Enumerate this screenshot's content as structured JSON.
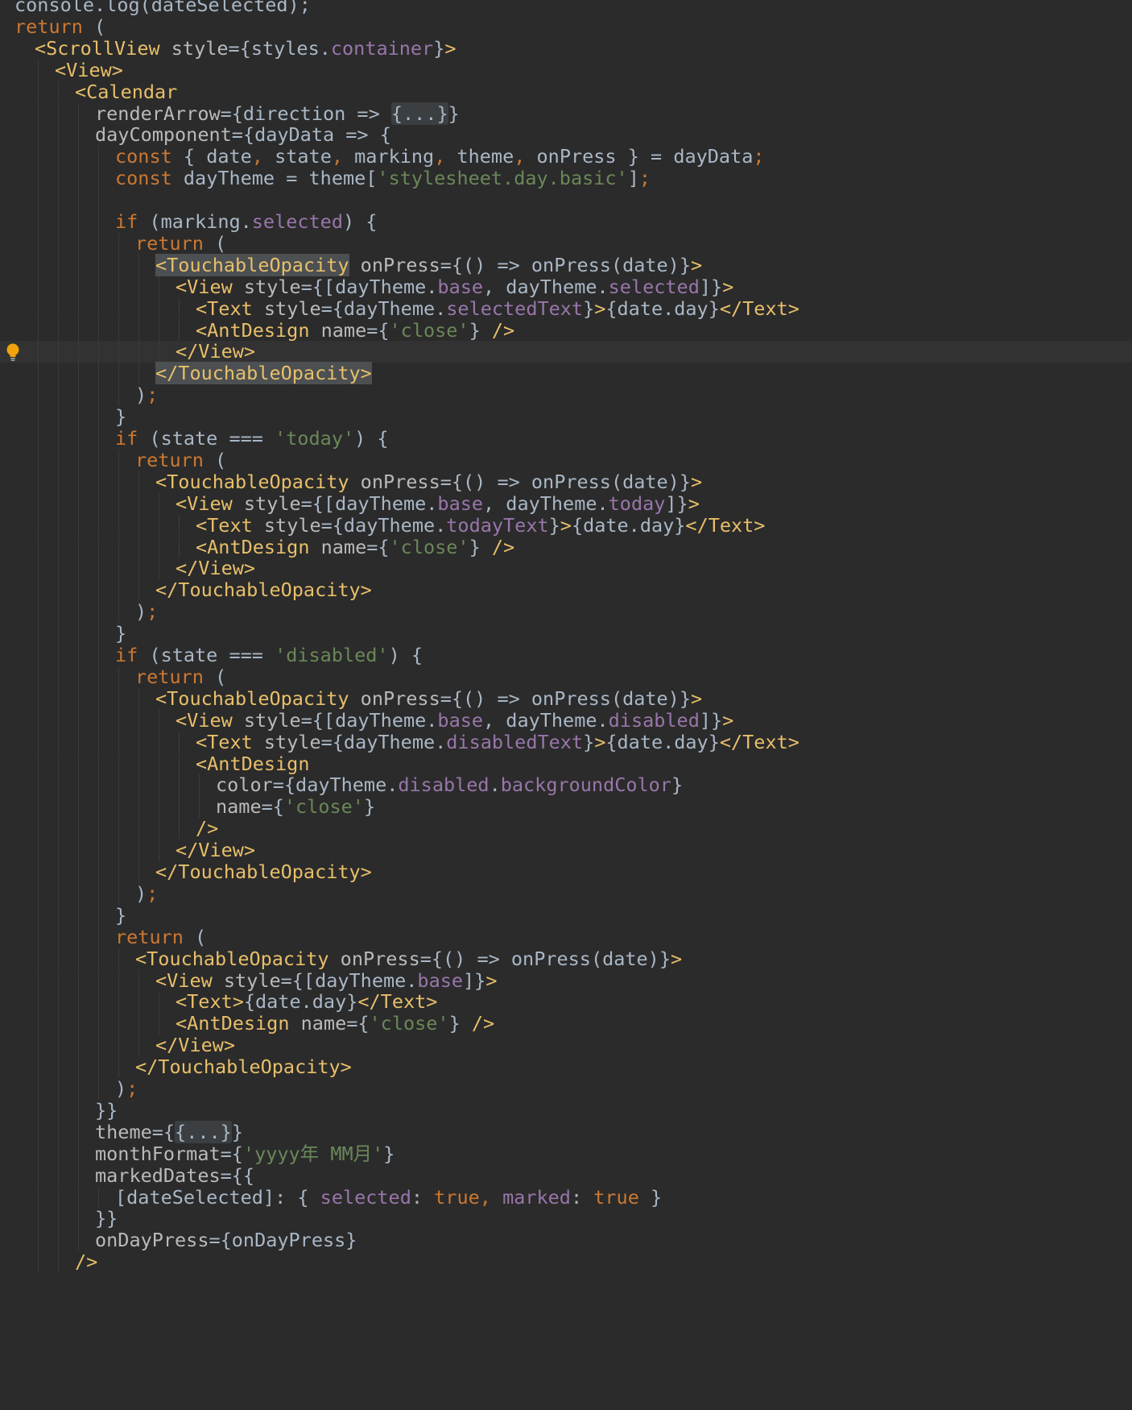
{
  "editor": {
    "theme": "darcula",
    "colors": {
      "background": "#2b2b2b",
      "current_line": "#323232",
      "keyword": "#cc7832",
      "tag": "#e8bf6a",
      "attribute": "#bababa",
      "property": "#9876aa",
      "string": "#6a8759",
      "default": "#a9b7c6",
      "highlight": "#4c5052"
    },
    "gutter_icon": "lightbulb-icon",
    "current_line_index": 16,
    "lines": [
      {
        "indent": 0,
        "tokens": [
          {
            "t": "console.log(dateSelected);",
            "c": "plain"
          }
        ]
      },
      {
        "indent": 0,
        "tokens": [
          {
            "t": "return",
            "c": "kw"
          },
          {
            "t": " (",
            "c": "plain"
          }
        ]
      },
      {
        "indent": 1,
        "tokens": [
          {
            "t": "<ScrollView",
            "c": "tag"
          },
          {
            "t": " style",
            "c": "attr"
          },
          {
            "t": "={styles.",
            "c": "plain"
          },
          {
            "t": "container",
            "c": "prop"
          },
          {
            "t": "}",
            "c": "plain"
          },
          {
            "t": ">",
            "c": "tag"
          }
        ]
      },
      {
        "indent": 2,
        "tokens": [
          {
            "t": "<View>",
            "c": "tag"
          }
        ]
      },
      {
        "indent": 3,
        "tokens": [
          {
            "t": "<Calendar",
            "c": "tag"
          }
        ]
      },
      {
        "indent": 4,
        "tokens": [
          {
            "t": "renderArrow",
            "c": "attr"
          },
          {
            "t": "={direction => ",
            "c": "plain"
          },
          {
            "t": "{...}",
            "c": "fold"
          },
          {
            "t": "}",
            "c": "plain"
          }
        ]
      },
      {
        "indent": 4,
        "tokens": [
          {
            "t": "dayComponent",
            "c": "attr"
          },
          {
            "t": "={dayData => {",
            "c": "plain"
          }
        ]
      },
      {
        "indent": 5,
        "tokens": [
          {
            "t": "const",
            "c": "kw"
          },
          {
            "t": " { date",
            "c": "plain"
          },
          {
            "t": ",",
            "c": "kw"
          },
          {
            "t": " state",
            "c": "plain"
          },
          {
            "t": ",",
            "c": "kw"
          },
          {
            "t": " marking",
            "c": "plain"
          },
          {
            "t": ",",
            "c": "kw"
          },
          {
            "t": " theme",
            "c": "plain"
          },
          {
            "t": ",",
            "c": "kw"
          },
          {
            "t": " onPress } = dayData",
            "c": "plain"
          },
          {
            "t": ";",
            "c": "kw"
          }
        ]
      },
      {
        "indent": 5,
        "tokens": [
          {
            "t": "const",
            "c": "kw"
          },
          {
            "t": " dayTheme = theme[",
            "c": "plain"
          },
          {
            "t": "'stylesheet.day.basic'",
            "c": "str"
          },
          {
            "t": "]",
            "c": "plain"
          },
          {
            "t": ";",
            "c": "kw"
          }
        ]
      },
      {
        "indent": 5,
        "tokens": []
      },
      {
        "indent": 5,
        "tokens": [
          {
            "t": "if",
            "c": "kw"
          },
          {
            "t": " (marking.",
            "c": "plain"
          },
          {
            "t": "selected",
            "c": "prop"
          },
          {
            "t": ") {",
            "c": "plain"
          }
        ]
      },
      {
        "indent": 6,
        "tokens": [
          {
            "t": "return",
            "c": "kw"
          },
          {
            "t": " (",
            "c": "plain"
          }
        ]
      },
      {
        "indent": 7,
        "tokens": [
          {
            "t": "<TouchableOpacity",
            "c": "tag",
            "hl": true
          },
          {
            "t": " onPress",
            "c": "attr"
          },
          {
            "t": "={() => onPress(date)}",
            "c": "plain"
          },
          {
            "t": ">",
            "c": "tag"
          }
        ]
      },
      {
        "indent": 8,
        "tokens": [
          {
            "t": "<View",
            "c": "tag"
          },
          {
            "t": " style",
            "c": "attr"
          },
          {
            "t": "={[dayTheme.",
            "c": "plain"
          },
          {
            "t": "base",
            "c": "prop"
          },
          {
            "t": ", dayTheme.",
            "c": "plain"
          },
          {
            "t": "selected",
            "c": "prop"
          },
          {
            "t": "]}",
            "c": "plain"
          },
          {
            "t": ">",
            "c": "tag"
          }
        ]
      },
      {
        "indent": 9,
        "tokens": [
          {
            "t": "<Text",
            "c": "tag"
          },
          {
            "t": " style",
            "c": "attr"
          },
          {
            "t": "={dayTheme.",
            "c": "plain"
          },
          {
            "t": "selectedText",
            "c": "prop"
          },
          {
            "t": "}",
            "c": "plain"
          },
          {
            "t": ">",
            "c": "tag"
          },
          {
            "t": "{date.day}",
            "c": "plain"
          },
          {
            "t": "</Text>",
            "c": "tag"
          }
        ]
      },
      {
        "indent": 9,
        "tokens": [
          {
            "t": "<AntDesign",
            "c": "tag"
          },
          {
            "t": " name",
            "c": "attr"
          },
          {
            "t": "={",
            "c": "plain"
          },
          {
            "t": "'close'",
            "c": "str"
          },
          {
            "t": "} ",
            "c": "plain"
          },
          {
            "t": "/>",
            "c": "tag"
          }
        ]
      },
      {
        "indent": 8,
        "tokens": [
          {
            "t": "</View>",
            "c": "tag"
          }
        ]
      },
      {
        "indent": 7,
        "tokens": [
          {
            "t": "</TouchableOpacity>",
            "c": "tag",
            "hl": true
          }
        ]
      },
      {
        "indent": 6,
        "tokens": [
          {
            "t": ")",
            "c": "plain"
          },
          {
            "t": ";",
            "c": "kw"
          }
        ]
      },
      {
        "indent": 5,
        "tokens": [
          {
            "t": "}",
            "c": "plain"
          }
        ]
      },
      {
        "indent": 5,
        "tokens": [
          {
            "t": "if",
            "c": "kw"
          },
          {
            "t": " (state === ",
            "c": "plain"
          },
          {
            "t": "'today'",
            "c": "str"
          },
          {
            "t": ") {",
            "c": "plain"
          }
        ]
      },
      {
        "indent": 6,
        "tokens": [
          {
            "t": "return",
            "c": "kw"
          },
          {
            "t": " (",
            "c": "plain"
          }
        ]
      },
      {
        "indent": 7,
        "tokens": [
          {
            "t": "<TouchableOpacity",
            "c": "tag"
          },
          {
            "t": " onPress",
            "c": "attr"
          },
          {
            "t": "={() => onPress(date)}",
            "c": "plain"
          },
          {
            "t": ">",
            "c": "tag"
          }
        ]
      },
      {
        "indent": 8,
        "tokens": [
          {
            "t": "<View",
            "c": "tag"
          },
          {
            "t": " style",
            "c": "attr"
          },
          {
            "t": "={[dayTheme.",
            "c": "plain"
          },
          {
            "t": "base",
            "c": "prop"
          },
          {
            "t": ", dayTheme.",
            "c": "plain"
          },
          {
            "t": "today",
            "c": "prop"
          },
          {
            "t": "]}",
            "c": "plain"
          },
          {
            "t": ">",
            "c": "tag"
          }
        ]
      },
      {
        "indent": 9,
        "tokens": [
          {
            "t": "<Text",
            "c": "tag"
          },
          {
            "t": " style",
            "c": "attr"
          },
          {
            "t": "={dayTheme.",
            "c": "plain"
          },
          {
            "t": "todayText",
            "c": "prop"
          },
          {
            "t": "}",
            "c": "plain"
          },
          {
            "t": ">",
            "c": "tag"
          },
          {
            "t": "{date.day}",
            "c": "plain"
          },
          {
            "t": "</Text>",
            "c": "tag"
          }
        ]
      },
      {
        "indent": 9,
        "tokens": [
          {
            "t": "<AntDesign",
            "c": "tag"
          },
          {
            "t": " name",
            "c": "attr"
          },
          {
            "t": "={",
            "c": "plain"
          },
          {
            "t": "'close'",
            "c": "str"
          },
          {
            "t": "} ",
            "c": "plain"
          },
          {
            "t": "/>",
            "c": "tag"
          }
        ]
      },
      {
        "indent": 8,
        "tokens": [
          {
            "t": "</View>",
            "c": "tag"
          }
        ]
      },
      {
        "indent": 7,
        "tokens": [
          {
            "t": "</TouchableOpacity>",
            "c": "tag"
          }
        ]
      },
      {
        "indent": 6,
        "tokens": [
          {
            "t": ")",
            "c": "plain"
          },
          {
            "t": ";",
            "c": "kw"
          }
        ]
      },
      {
        "indent": 5,
        "tokens": [
          {
            "t": "}",
            "c": "plain"
          }
        ]
      },
      {
        "indent": 5,
        "tokens": [
          {
            "t": "if",
            "c": "kw"
          },
          {
            "t": " (state === ",
            "c": "plain"
          },
          {
            "t": "'disabled'",
            "c": "str"
          },
          {
            "t": ") {",
            "c": "plain"
          }
        ]
      },
      {
        "indent": 6,
        "tokens": [
          {
            "t": "return",
            "c": "kw"
          },
          {
            "t": " (",
            "c": "plain"
          }
        ]
      },
      {
        "indent": 7,
        "tokens": [
          {
            "t": "<TouchableOpacity",
            "c": "tag"
          },
          {
            "t": " onPress",
            "c": "attr"
          },
          {
            "t": "={() => onPress(date)}",
            "c": "plain"
          },
          {
            "t": ">",
            "c": "tag"
          }
        ]
      },
      {
        "indent": 8,
        "tokens": [
          {
            "t": "<View",
            "c": "tag"
          },
          {
            "t": " style",
            "c": "attr"
          },
          {
            "t": "={[dayTheme.",
            "c": "plain"
          },
          {
            "t": "base",
            "c": "prop"
          },
          {
            "t": ", dayTheme.",
            "c": "plain"
          },
          {
            "t": "disabled",
            "c": "prop"
          },
          {
            "t": "]}",
            "c": "plain"
          },
          {
            "t": ">",
            "c": "tag"
          }
        ]
      },
      {
        "indent": 9,
        "tokens": [
          {
            "t": "<Text",
            "c": "tag"
          },
          {
            "t": " style",
            "c": "attr"
          },
          {
            "t": "={dayTheme.",
            "c": "plain"
          },
          {
            "t": "disabledText",
            "c": "prop"
          },
          {
            "t": "}",
            "c": "plain"
          },
          {
            "t": ">",
            "c": "tag"
          },
          {
            "t": "{date.day}",
            "c": "plain"
          },
          {
            "t": "</Text>",
            "c": "tag"
          }
        ]
      },
      {
        "indent": 9,
        "tokens": [
          {
            "t": "<AntDesign",
            "c": "tag"
          }
        ]
      },
      {
        "indent": 10,
        "tokens": [
          {
            "t": "color",
            "c": "attr"
          },
          {
            "t": "={dayTheme.",
            "c": "plain"
          },
          {
            "t": "disabled",
            "c": "prop"
          },
          {
            "t": ".",
            "c": "plain"
          },
          {
            "t": "backgroundColor",
            "c": "prop"
          },
          {
            "t": "}",
            "c": "plain"
          }
        ]
      },
      {
        "indent": 10,
        "tokens": [
          {
            "t": "name",
            "c": "attr"
          },
          {
            "t": "={",
            "c": "plain"
          },
          {
            "t": "'close'",
            "c": "str"
          },
          {
            "t": "}",
            "c": "plain"
          }
        ]
      },
      {
        "indent": 9,
        "tokens": [
          {
            "t": "/>",
            "c": "tag"
          }
        ]
      },
      {
        "indent": 8,
        "tokens": [
          {
            "t": "</View>",
            "c": "tag"
          }
        ]
      },
      {
        "indent": 7,
        "tokens": [
          {
            "t": "</TouchableOpacity>",
            "c": "tag"
          }
        ]
      },
      {
        "indent": 6,
        "tokens": [
          {
            "t": ")",
            "c": "plain"
          },
          {
            "t": ";",
            "c": "kw"
          }
        ]
      },
      {
        "indent": 5,
        "tokens": [
          {
            "t": "}",
            "c": "plain"
          }
        ]
      },
      {
        "indent": 5,
        "tokens": [
          {
            "t": "return",
            "c": "kw"
          },
          {
            "t": " (",
            "c": "plain"
          }
        ]
      },
      {
        "indent": 6,
        "tokens": [
          {
            "t": "<TouchableOpacity",
            "c": "tag"
          },
          {
            "t": " onPress",
            "c": "attr"
          },
          {
            "t": "={() => onPress(date)}",
            "c": "plain"
          },
          {
            "t": ">",
            "c": "tag"
          }
        ]
      },
      {
        "indent": 7,
        "tokens": [
          {
            "t": "<View",
            "c": "tag"
          },
          {
            "t": " style",
            "c": "attr"
          },
          {
            "t": "={[dayTheme.",
            "c": "plain"
          },
          {
            "t": "base",
            "c": "prop"
          },
          {
            "t": "]}",
            "c": "plain"
          },
          {
            "t": ">",
            "c": "tag"
          }
        ]
      },
      {
        "indent": 8,
        "tokens": [
          {
            "t": "<Text>",
            "c": "tag"
          },
          {
            "t": "{date.day}",
            "c": "plain"
          },
          {
            "t": "</Text>",
            "c": "tag"
          }
        ]
      },
      {
        "indent": 8,
        "tokens": [
          {
            "t": "<AntDesign",
            "c": "tag"
          },
          {
            "t": " name",
            "c": "attr"
          },
          {
            "t": "={",
            "c": "plain"
          },
          {
            "t": "'close'",
            "c": "str"
          },
          {
            "t": "} ",
            "c": "plain"
          },
          {
            "t": "/>",
            "c": "tag"
          }
        ]
      },
      {
        "indent": 7,
        "tokens": [
          {
            "t": "</View>",
            "c": "tag"
          }
        ]
      },
      {
        "indent": 6,
        "tokens": [
          {
            "t": "</TouchableOpacity>",
            "c": "tag"
          }
        ]
      },
      {
        "indent": 5,
        "tokens": [
          {
            "t": ")",
            "c": "plain"
          },
          {
            "t": ";",
            "c": "kw"
          }
        ]
      },
      {
        "indent": 4,
        "tokens": [
          {
            "t": "}}",
            "c": "plain"
          }
        ]
      },
      {
        "indent": 4,
        "tokens": [
          {
            "t": "theme",
            "c": "attr"
          },
          {
            "t": "={",
            "c": "plain"
          },
          {
            "t": "{...}",
            "c": "fold"
          },
          {
            "t": "}",
            "c": "plain"
          }
        ]
      },
      {
        "indent": 4,
        "tokens": [
          {
            "t": "monthFormat",
            "c": "attr"
          },
          {
            "t": "={",
            "c": "plain"
          },
          {
            "t": "'yyyy年 MM月'",
            "c": "str"
          },
          {
            "t": "}",
            "c": "plain"
          }
        ]
      },
      {
        "indent": 4,
        "tokens": [
          {
            "t": "markedDates",
            "c": "attr"
          },
          {
            "t": "={{",
            "c": "plain"
          }
        ]
      },
      {
        "indent": 5,
        "tokens": [
          {
            "t": "[dateSelected]: { ",
            "c": "plain"
          },
          {
            "t": "selected",
            "c": "prop"
          },
          {
            "t": ": ",
            "c": "plain"
          },
          {
            "t": "true",
            "c": "kw"
          },
          {
            "t": ",",
            "c": "kw"
          },
          {
            "t": " ",
            "c": "plain"
          },
          {
            "t": "marked",
            "c": "prop"
          },
          {
            "t": ": ",
            "c": "plain"
          },
          {
            "t": "true",
            "c": "kw"
          },
          {
            "t": " }",
            "c": "plain"
          }
        ]
      },
      {
        "indent": 4,
        "tokens": [
          {
            "t": "}}",
            "c": "plain"
          }
        ]
      },
      {
        "indent": 4,
        "tokens": [
          {
            "t": "onDayPress",
            "c": "attr"
          },
          {
            "t": "={onDayPress}",
            "c": "plain"
          }
        ]
      },
      {
        "indent": 3,
        "tokens": [
          {
            "t": "/>",
            "c": "tag"
          }
        ]
      }
    ]
  }
}
